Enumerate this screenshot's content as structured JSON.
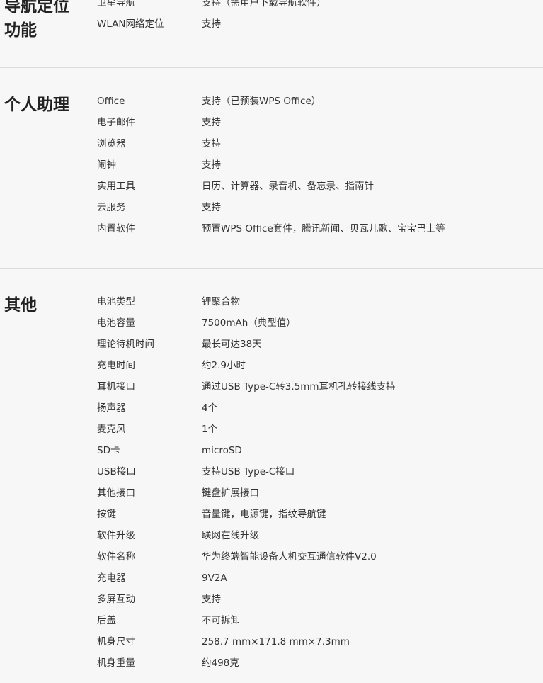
{
  "sections": [
    {
      "title_lines": [
        "导航定位",
        "功能"
      ],
      "rows": [
        {
          "label": "卫星导航",
          "value": "支持（需用户下载导航软件）"
        },
        {
          "label": "WLAN网络定位",
          "value": "支持"
        }
      ]
    },
    {
      "title_lines": [
        "个人助理"
      ],
      "rows": [
        {
          "label": "Office",
          "value": "支持（已预装WPS Office）"
        },
        {
          "label": "电子邮件",
          "value": "支持"
        },
        {
          "label": "浏览器",
          "value": "支持"
        },
        {
          "label": "闹钟",
          "value": "支持"
        },
        {
          "label": "实用工具",
          "value": "日历、计算器、录音机、备忘录、指南针"
        },
        {
          "label": "云服务",
          "value": "支持"
        },
        {
          "label": "内置软件",
          "value": "预置WPS Office套件，腾讯新闻、贝瓦儿歌、宝宝巴士等"
        }
      ]
    },
    {
      "title_lines": [
        "其他"
      ],
      "rows": [
        {
          "label": "电池类型",
          "value": "锂聚合物"
        },
        {
          "label": "电池容量",
          "value": "7500mAh（典型值）"
        },
        {
          "label": "理论待机时间",
          "value": "最长可达38天"
        },
        {
          "label": "充电时间",
          "value": "约2.9小时"
        },
        {
          "label": "耳机接口",
          "value": "通过USB Type-C转3.5mm耳机孔转接线支持"
        },
        {
          "label": "扬声器",
          "value": "4个"
        },
        {
          "label": "麦克风",
          "value": "1个"
        },
        {
          "label": "SD卡",
          "value": "microSD"
        },
        {
          "label": "USB接口",
          "value": "支持USB Type-C接口"
        },
        {
          "label": "其他接口",
          "value": "键盘扩展接口"
        },
        {
          "label": "按键",
          "value": "音量键，电源键，指纹导航键"
        },
        {
          "label": "软件升级",
          "value": "联网在线升级"
        },
        {
          "label": "软件名称",
          "value": "华为终端智能设备人机交互通信软件V2.0"
        },
        {
          "label": "充电器",
          "value": "9V2A"
        },
        {
          "label": "多屏互动",
          "value": "支持"
        },
        {
          "label": "后盖",
          "value": "不可拆卸"
        },
        {
          "label": "机身尺寸",
          "value": "258.7 mm×171.8 mm×7.3mm"
        },
        {
          "label": "机身重量",
          "value": "约498克"
        }
      ]
    }
  ]
}
